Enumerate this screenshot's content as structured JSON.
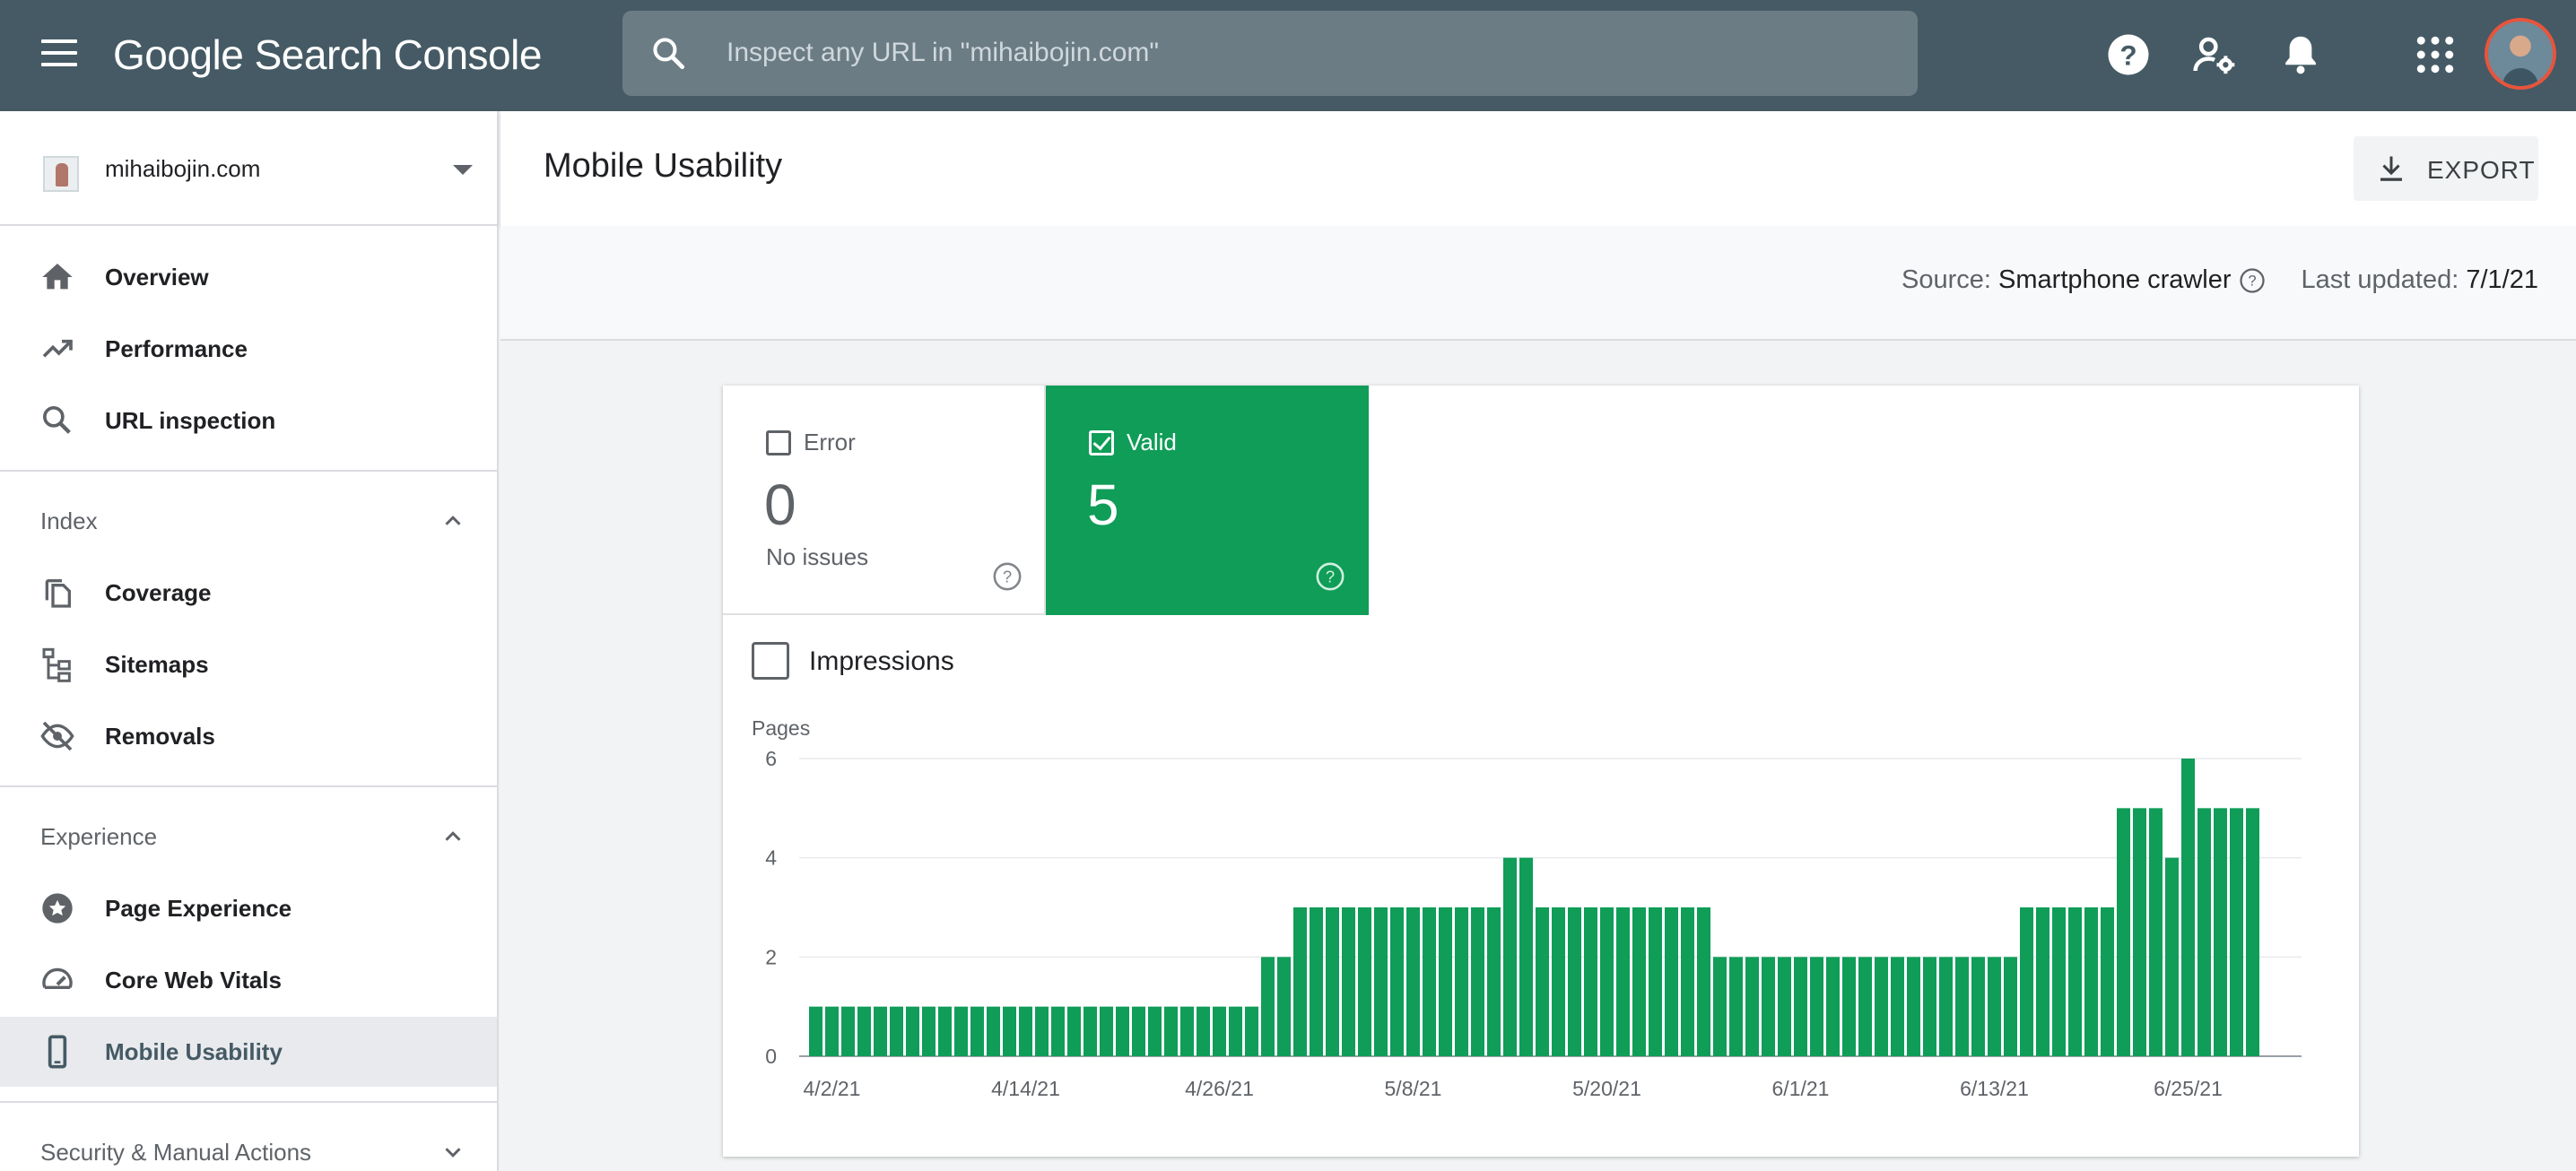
{
  "header": {
    "brand": "Google Search Console",
    "search_placeholder": "Inspect any URL in \"mihaibojin.com\"",
    "icons": [
      "menu-icon",
      "search-icon",
      "help-icon",
      "user-settings-icon",
      "notifications-icon",
      "apps-icon",
      "avatar"
    ]
  },
  "sidebar": {
    "property": "mihaibojin.com",
    "items_top": [
      {
        "label": "Overview",
        "icon": "home-icon"
      },
      {
        "label": "Performance",
        "icon": "trending-up-icon"
      },
      {
        "label": "URL inspection",
        "icon": "search-icon"
      }
    ],
    "index": {
      "title": "Index",
      "items": [
        {
          "label": "Coverage",
          "icon": "copy-icon"
        },
        {
          "label": "Sitemaps",
          "icon": "sitemap-icon"
        },
        {
          "label": "Removals",
          "icon": "visibility-off-icon"
        }
      ]
    },
    "experience": {
      "title": "Experience",
      "items": [
        {
          "label": "Page Experience",
          "icon": "star-badge-icon"
        },
        {
          "label": "Core Web Vitals",
          "icon": "speed-icon"
        },
        {
          "label": "Mobile Usability",
          "icon": "smartphone-icon"
        }
      ]
    },
    "security": {
      "title": "Security & Manual Actions"
    }
  },
  "main": {
    "title": "Mobile Usability",
    "export_label": "EXPORT",
    "source_label": "Source:",
    "source_value": "Smartphone crawler",
    "updated_label": "Last updated:",
    "updated_value": "7/1/21",
    "tiles": {
      "error": {
        "label": "Error",
        "count": "0",
        "sub": "No issues",
        "checked": false
      },
      "valid": {
        "label": "Valid",
        "count": "5",
        "checked": true
      }
    },
    "impressions_label": "Impressions"
  },
  "colors": {
    "topbar": "#455a64",
    "valid_green": "#0f9d58",
    "active_nav": "#e8eaed"
  },
  "chart_data": {
    "type": "bar",
    "ylabel": "Pages",
    "ylim": [
      0,
      6
    ],
    "yticks": [
      0,
      2,
      4,
      6
    ],
    "xtick_labels": [
      "4/2/21",
      "4/14/21",
      "4/26/21",
      "5/8/21",
      "5/20/21",
      "6/1/21",
      "6/13/21",
      "6/25/21"
    ],
    "series": [
      {
        "color": "#0f9d58",
        "values": [
          1,
          1,
          1,
          1,
          1,
          1,
          1,
          1,
          1,
          1,
          1,
          1,
          1,
          1,
          1,
          1,
          1,
          1,
          1,
          1,
          1,
          1,
          1,
          1,
          1,
          1,
          1,
          1,
          2,
          2,
          3,
          3,
          3,
          3,
          3,
          3,
          3,
          3,
          3,
          3,
          3,
          3,
          3,
          4,
          4,
          3,
          3,
          3,
          3,
          3,
          3,
          3,
          3,
          3,
          3,
          3,
          2,
          2,
          2,
          2,
          2,
          2,
          2,
          2,
          2,
          2,
          2,
          2,
          2,
          2,
          2,
          2,
          2,
          2,
          2,
          3,
          3,
          3,
          3,
          3,
          3,
          5,
          5,
          5,
          4,
          6,
          5,
          5,
          5,
          5
        ]
      }
    ]
  }
}
